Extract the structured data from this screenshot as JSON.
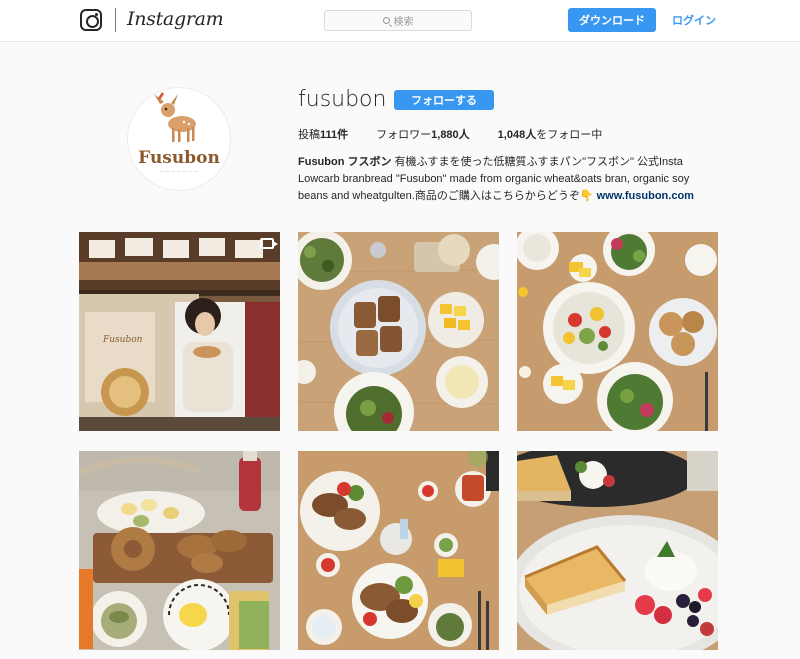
{
  "header": {
    "wordmark": "Instagram",
    "search_placeholder": "検索",
    "download_label": "ダウンロード",
    "login_label": "ログイン"
  },
  "profile": {
    "avatar_text": "Fusubon",
    "username": "fusubon",
    "follow_label": "フォローする",
    "stats": {
      "posts_label": "投稿",
      "posts_count": "111件",
      "followers_label": "フォロワー",
      "followers_count": "1,880人",
      "following_count": "1,048人",
      "following_label": "をフォロー中"
    },
    "bio": {
      "name": "Fusubon フスボン",
      "text": " 有機ふすまを使った低糖質ふすまパン\"フスボン\" 公式Insta Lowcarb branbread \"Fusubon\" made from organic wheat&oats bran, organic soy beans and wheatgulten.商品のご購入はこちらからどうぞ👇 ",
      "link": "www.fusubon.com"
    }
  },
  "colors": {
    "accent": "#3897f0",
    "background": "#fafafa",
    "text": "#262626"
  }
}
